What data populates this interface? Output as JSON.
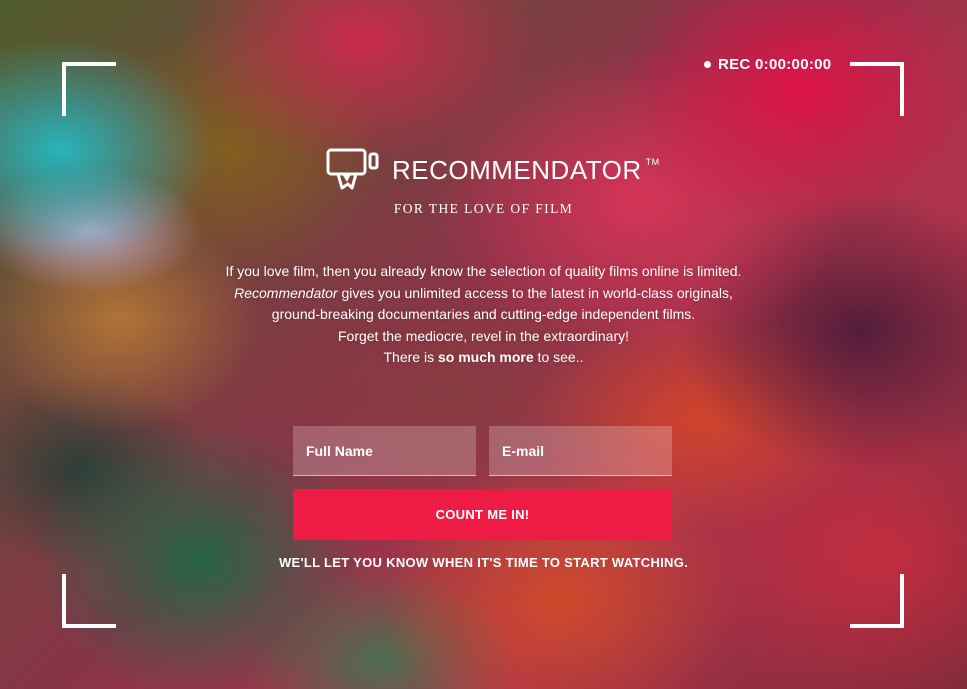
{
  "recording": {
    "indicator": "REC 0:00:00:00"
  },
  "brand": {
    "name": "RECOMMENDATOR",
    "trademark": "TM",
    "logo_icon": "film-camera-logo-icon",
    "tagline": "FOR THE LOVE OF FILM"
  },
  "intro": {
    "line1": "If you love film, then you already know the selection of quality films online is limited.",
    "line2_em": "Recommendator",
    "line2_rest": " gives you unlimited access to the latest in world-class originals,",
    "line3": "ground-breaking documentaries and cutting-edge independent films.",
    "line4": "Forget the mediocre, revel in the extraordinary!",
    "line5_pre": "There is ",
    "line5_strong": "so much more",
    "line5_post": " to see.."
  },
  "form": {
    "name_placeholder": "Full Name",
    "email_placeholder": "E-mail",
    "submit_label": "COUNT ME IN!",
    "notice": "WE'LL LET YOU KNOW WHEN IT'S TIME TO START WATCHING."
  },
  "colors": {
    "accent": "#ee1b45",
    "text": "#ffffff"
  }
}
